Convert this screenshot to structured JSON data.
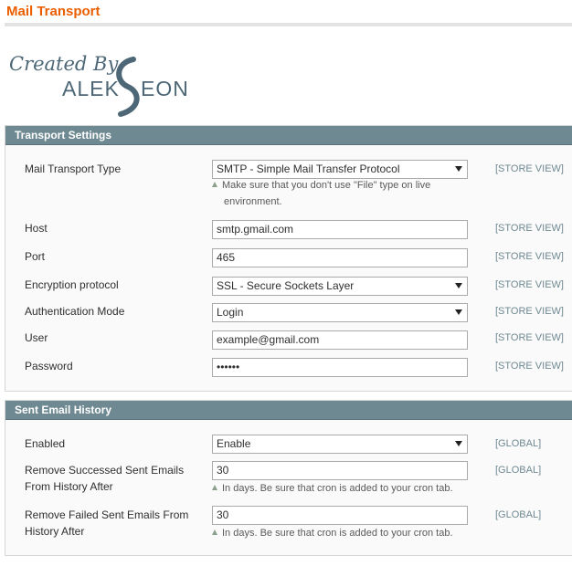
{
  "page": {
    "title": "Mail Transport"
  },
  "logo": {
    "line1": "Created By",
    "brand": "ALEKSEON"
  },
  "transport": {
    "header": "Transport Settings",
    "type_label": "Mail Transport Type",
    "type_value": "SMTP - Simple Mail Transfer Protocol",
    "type_note_1": "Make sure that you don't use \"File\" type on live",
    "type_note_2": "environment.",
    "host_label": "Host",
    "host_value": "smtp.gmail.com",
    "port_label": "Port",
    "port_value": "465",
    "enc_label": "Encryption protocol",
    "enc_value": "SSL - Secure Sockets Layer",
    "auth_label": "Authentication Mode",
    "auth_value": "Login",
    "user_label": "User",
    "user_value": "example@gmail.com",
    "pass_label": "Password",
    "pass_value": "••••••",
    "scope": "[STORE VIEW]"
  },
  "history": {
    "header": "Sent Email History",
    "enabled_label": "Enabled",
    "enabled_value": "Enable",
    "success_label_1": "Remove Successed Sent Emails",
    "success_label_2": "From History After",
    "success_value": "30",
    "success_note": "In days. Be sure that cron is added to your cron tab.",
    "failed_label_1": "Remove Failed Sent Emails From",
    "failed_label_2": "History After",
    "failed_value": "30",
    "failed_note": "In days. Be sure that cron is added to your cron tab.",
    "scope": "[GLOBAL]"
  },
  "colors": {
    "title": "#eb5e00",
    "section_header": "#6f8992",
    "scope_text": "#6f8992",
    "logo_text": "#4d6776"
  },
  "icons": {
    "select_arrow": "chevron-down-icon",
    "note_marker": "triangle-up-icon"
  }
}
